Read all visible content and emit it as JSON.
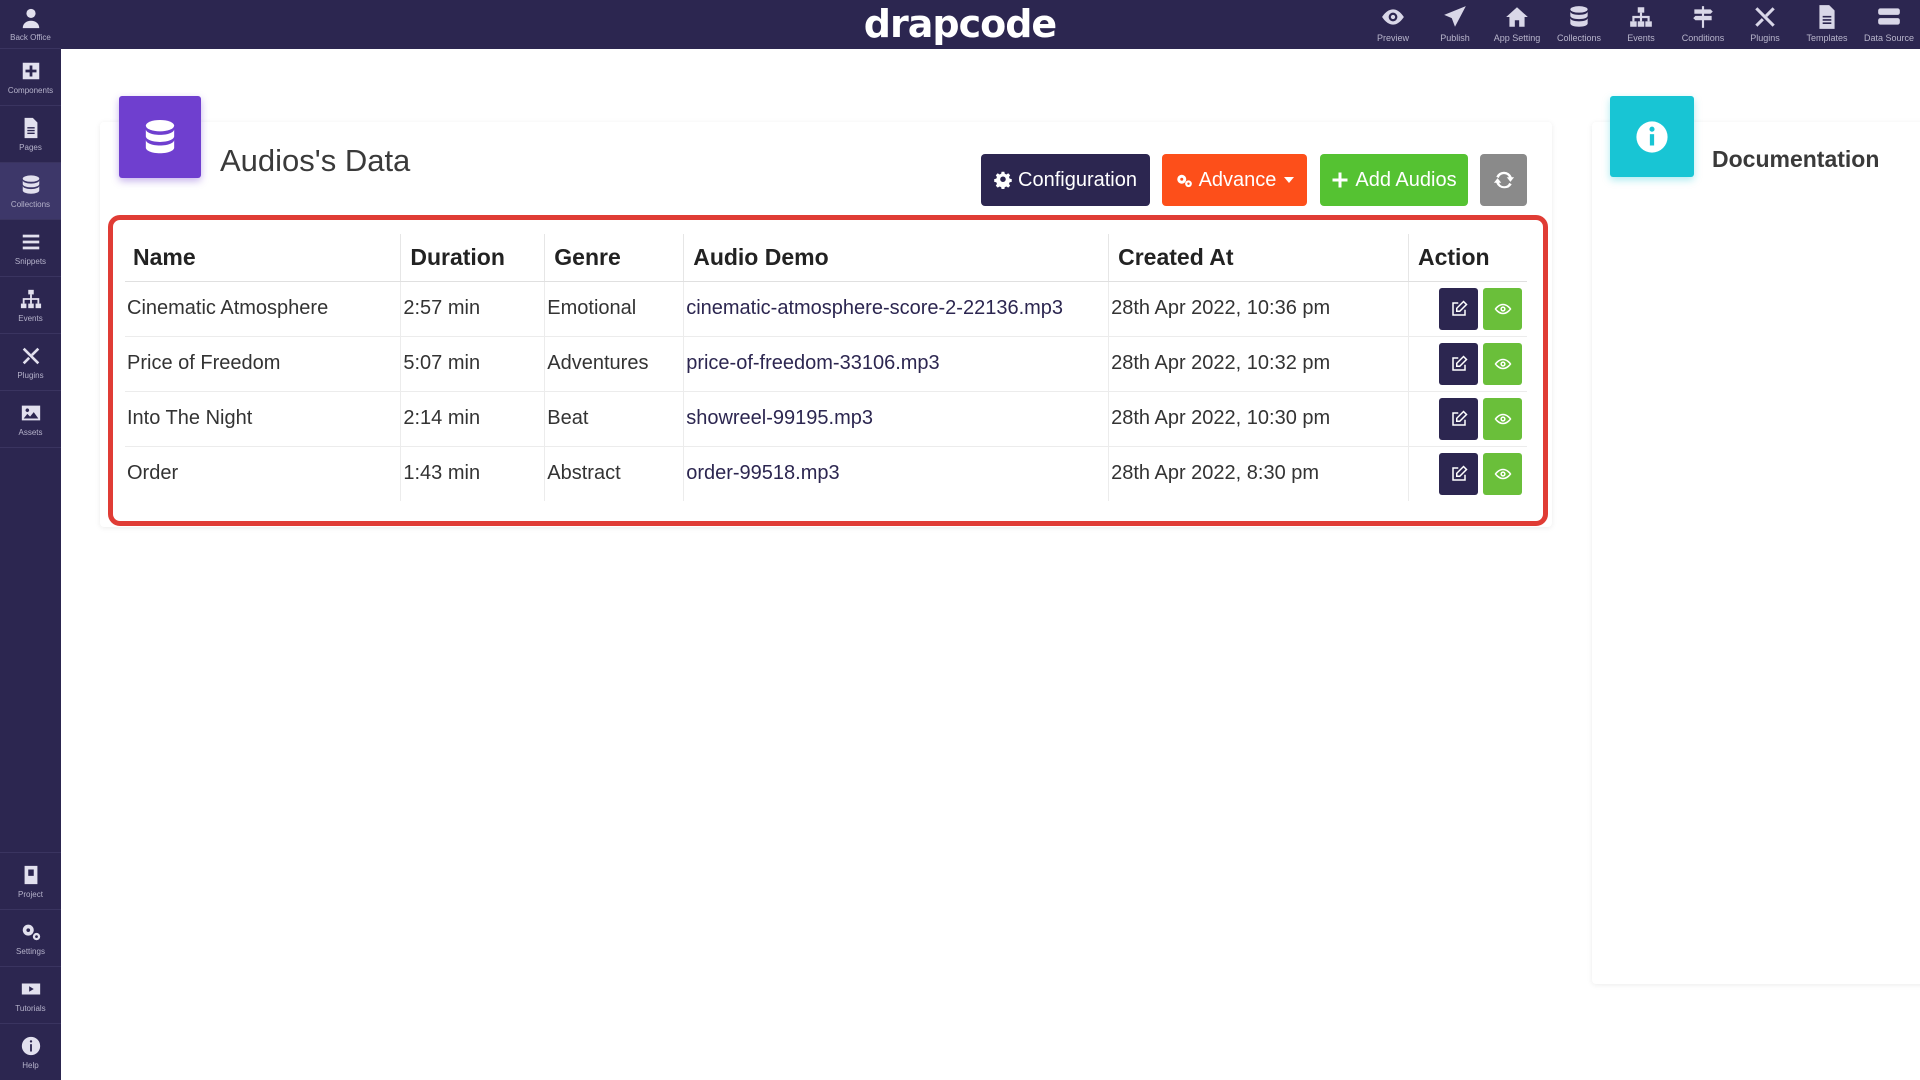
{
  "brand": "drapcode",
  "topnav": [
    {
      "label": "Preview",
      "icon": "eye-icon"
    },
    {
      "label": "Publish",
      "icon": "paper-plane-icon"
    },
    {
      "label": "App Setting",
      "icon": "home-icon"
    },
    {
      "label": "Collections",
      "icon": "database-icon"
    },
    {
      "label": "Events",
      "icon": "sitemap-icon"
    },
    {
      "label": "Conditions",
      "icon": "signpost-icon"
    },
    {
      "label": "Plugins",
      "icon": "tools-icon"
    },
    {
      "label": "Templates",
      "icon": "file-icon"
    },
    {
      "label": "Data Source",
      "icon": "server-icon"
    }
  ],
  "sidebar": {
    "items": [
      {
        "label": "Back Office",
        "icon": "user-icon"
      },
      {
        "label": "Components",
        "icon": "plus-square-icon"
      },
      {
        "label": "Pages",
        "icon": "file-icon"
      },
      {
        "label": "Collections",
        "icon": "database-icon"
      },
      {
        "label": "Snippets",
        "icon": "list-icon"
      },
      {
        "label": "Events",
        "icon": "sitemap-icon"
      },
      {
        "label": "Plugins",
        "icon": "tools-icon"
      },
      {
        "label": "Assets",
        "icon": "image-icon"
      }
    ],
    "bottom": [
      {
        "label": "Project",
        "icon": "project-icon"
      },
      {
        "label": "Settings",
        "icon": "cogs-icon"
      },
      {
        "label": "Tutorials",
        "icon": "youtube-icon"
      },
      {
        "label": "Help",
        "icon": "info-icon"
      }
    ]
  },
  "main": {
    "title": "Audios's Data",
    "buttons": {
      "configuration": "Configuration",
      "advance": "Advance",
      "add": "Add Audios"
    },
    "table": {
      "headers": [
        "Name",
        "Duration",
        "Genre",
        "Audio Demo",
        "Created At",
        "Action"
      ],
      "rows": [
        [
          "Cinematic Atmosphere",
          "2:57 min",
          "Emotional",
          "cinematic-atmosphere-score-2-22136.mp3",
          "28th Apr 2022, 10:36 pm"
        ],
        [
          "Price of Freedom",
          "5:07 min",
          "Adventures",
          "price-of-freedom-33106.mp3",
          "28th Apr 2022, 10:32 pm"
        ],
        [
          "Into The Night",
          "2:14 min",
          "Beat",
          "showreel-99195.mp3",
          "28th Apr 2022, 10:30 pm"
        ],
        [
          "Order",
          "1:43 min",
          "Abstract",
          "order-99518.mp3",
          "28th Apr 2022, 8:30 pm"
        ]
      ]
    }
  },
  "documentation": {
    "title": "Documentation"
  },
  "colors": {
    "nav": "#2c2650",
    "accent_purple": "#6f3fcf",
    "advance": "#fd4f1a",
    "add": "#55c232",
    "refresh": "#8a8a8a",
    "view": "#6abf3a",
    "doc_icon": "#18c5d4",
    "highlight": "#e03c35"
  }
}
